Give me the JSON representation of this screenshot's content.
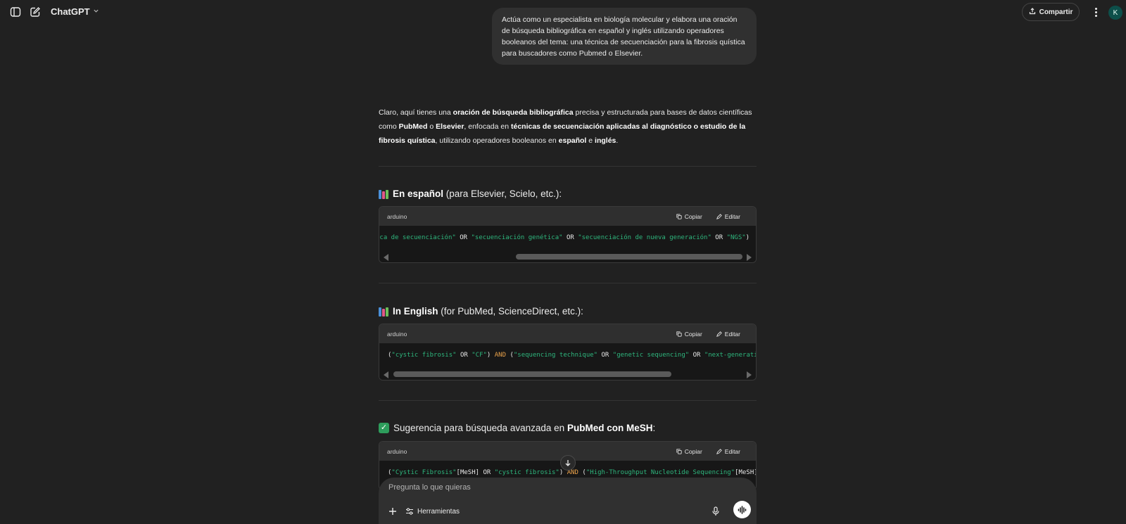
{
  "header": {
    "model_name": "ChatGPT",
    "share_label": "Compartir",
    "avatar_initial": "K"
  },
  "user_message": "Actúa como un especialista en biología molecular y elabora una oración de búsqueda bibliográfica en español y inglés utilizando operadores booleanos del tema: una técnica de secuenciación para la fibrosis quística para buscadores como Pubmed o Elsevier.",
  "assistant": {
    "intro": {
      "t1": "Claro, aquí tienes una ",
      "b1": "oración de búsqueda bibliográfica",
      "t2": " precisa y estructurada para bases de datos científicas como ",
      "b2": "PubMed",
      "t3": " o ",
      "b3": "Elsevier",
      "t4": ", enfocada en ",
      "b4": "técnicas de secuenciación aplicadas al diagnóstico o estudio de la fibrosis quística",
      "t5": ", utilizando operadores booleanos en ",
      "b5": "español",
      "t6": " e ",
      "b6": "inglés",
      "t7": "."
    },
    "sections": [
      {
        "title_bold": "En español",
        "title_rest": " (para Elsevier, Scielo, etc.):",
        "icon": "books-icon"
      },
      {
        "title_bold": "In English",
        "title_rest": " (for PubMed, ScienceDirect, etc.):",
        "icon": "books-icon"
      },
      {
        "title_pre": "Sugerencia para búsqueda avanzada en ",
        "title_bold": "PubMed con MeSH",
        "title_rest": ":",
        "icon": "check-icon"
      }
    ],
    "code_blocks": [
      {
        "language": "arduino",
        "copy_label": "Copiar",
        "edit_label": "Editar",
        "tokens": [
          {
            "t": "ica de secuenciación\"",
            "c": "s"
          },
          {
            "t": " OR ",
            "c": ""
          },
          {
            "t": "\"secuenciación genética\"",
            "c": "s"
          },
          {
            "t": " OR ",
            "c": ""
          },
          {
            "t": "\"secuenciación de nueva generación\"",
            "c": "s"
          },
          {
            "t": " OR ",
            "c": ""
          },
          {
            "t": "\"NGS\"",
            "c": "s"
          },
          {
            "t": ")",
            "c": ""
          }
        ]
      },
      {
        "language": "arduino",
        "copy_label": "Copiar",
        "edit_label": "Editar",
        "tokens": [
          {
            "t": "(",
            "c": ""
          },
          {
            "t": "\"cystic fibrosis\"",
            "c": "s"
          },
          {
            "t": " OR ",
            "c": ""
          },
          {
            "t": "\"CF\"",
            "c": "s"
          },
          {
            "t": ") ",
            "c": ""
          },
          {
            "t": "AND",
            "c": "k"
          },
          {
            "t": " (",
            "c": ""
          },
          {
            "t": "\"sequencing technique\"",
            "c": "s"
          },
          {
            "t": " OR ",
            "c": ""
          },
          {
            "t": "\"genetic sequencing\"",
            "c": "s"
          },
          {
            "t": " OR ",
            "c": ""
          },
          {
            "t": "\"next-generatio",
            "c": "s"
          }
        ]
      },
      {
        "language": "arduino",
        "copy_label": "Copiar",
        "edit_label": "Editar",
        "tokens": [
          {
            "t": "(",
            "c": ""
          },
          {
            "t": "\"Cystic Fibrosis\"",
            "c": "s"
          },
          {
            "t": "[MeSH] OR ",
            "c": ""
          },
          {
            "t": "\"cystic fibrosis\"",
            "c": "s"
          },
          {
            "t": ") ",
            "c": ""
          },
          {
            "t": "AND",
            "c": "k"
          },
          {
            "t": " (",
            "c": ""
          },
          {
            "t": "\"High-Throughput Nucleotide Sequencing\"",
            "c": "s"
          },
          {
            "t": "[MeSH]",
            "c": ""
          }
        ]
      }
    ]
  },
  "composer": {
    "placeholder": "Pregunta lo que quieras",
    "tools_label": "Herramientas"
  },
  "colors": {
    "background": "#212121",
    "string_token": "#2eb67d",
    "keyword_token": "#e8a14a",
    "avatar": "#0d4f4a"
  }
}
